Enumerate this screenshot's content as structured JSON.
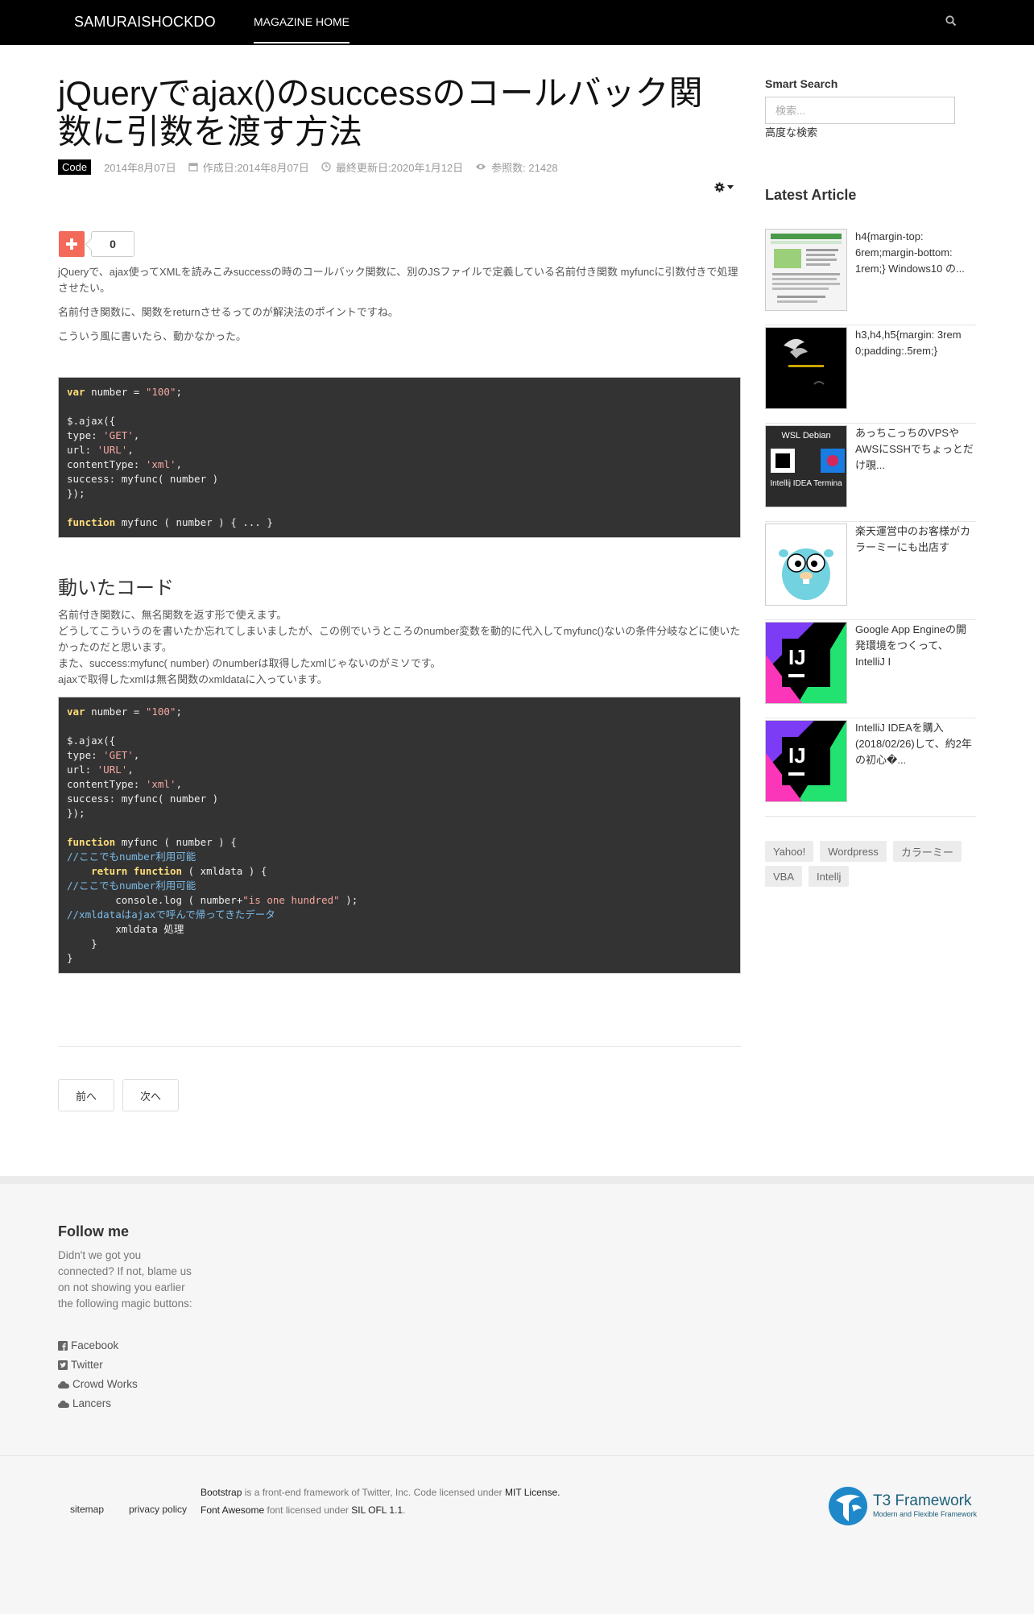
{
  "navbar": {
    "brand": "SAMURAISHOCKDO",
    "home": "MAGAZINE HOME",
    "search_icon": "search-icon"
  },
  "article": {
    "title": "jQueryでajax()のsuccessのコールバック関数に引数を渡す方法",
    "category": "Code",
    "published": "2014年8月07日",
    "created": "作成日:2014年8月07日",
    "modified": "最終更新日:2020年1月12日",
    "hits": "参照数: 21428",
    "share_count": "0",
    "p1": "jQueryで、ajax使ってXMLを読みこみsuccessの時のコールバック関数に、別のJSファイルで定義している名前付き関数 myfuncに引数付きで処理させたい。",
    "p2": "名前付き関数に、関数をreturnさせるってのが解決法のポイントですね。",
    "p3": "こういう風に書いたら、動かなかった。",
    "code1": [
      [
        {
          "t": "var",
          "c": "kw"
        },
        {
          "t": " number = "
        },
        {
          "t": "\"100\"",
          "c": "str"
        },
        {
          "t": ";"
        }
      ],
      [],
      [
        {
          "t": "$.ajax({"
        }
      ],
      [
        {
          "t": "type: "
        },
        {
          "t": "'GET'",
          "c": "str"
        },
        {
          "t": ","
        }
      ],
      [
        {
          "t": "url: "
        },
        {
          "t": "'URL'",
          "c": "str"
        },
        {
          "t": ","
        }
      ],
      [
        {
          "t": "contentType: "
        },
        {
          "t": "'xml'",
          "c": "str"
        },
        {
          "t": ","
        }
      ],
      [
        {
          "t": "success: myfunc( number )"
        }
      ],
      [
        {
          "t": "});"
        }
      ],
      [],
      [
        {
          "t": "function",
          "c": "kw"
        },
        {
          "t": " myfunc ( number ) { ... }"
        }
      ]
    ],
    "heading2": "動いたコード",
    "p4": "名前付き関数に、無名関数を返す形で使えます。\nどうしてこういうのを書いたか忘れてしまいましたが、この例でいうところのnumber変数を動的に代入してmyfunc()ないの条件分岐などに使いたかったのだと思います。\nまた、success:myfunc( number) のnumberは取得したxmlじゃないのがミソです。\najaxで取得したxmlは無名関数のxmldataに入っています。",
    "code2": [
      [
        {
          "t": "var",
          "c": "kw"
        },
        {
          "t": " number = "
        },
        {
          "t": "\"100\"",
          "c": "str"
        },
        {
          "t": ";"
        }
      ],
      [],
      [
        {
          "t": "$.ajax({"
        }
      ],
      [
        {
          "t": "type: "
        },
        {
          "t": "'GET'",
          "c": "str"
        },
        {
          "t": ","
        }
      ],
      [
        {
          "t": "url: "
        },
        {
          "t": "'URL'",
          "c": "str"
        },
        {
          "t": ","
        }
      ],
      [
        {
          "t": "contentType: "
        },
        {
          "t": "'xml'",
          "c": "str"
        },
        {
          "t": ","
        }
      ],
      [
        {
          "t": "success: myfunc( number )"
        }
      ],
      [
        {
          "t": "});"
        }
      ],
      [],
      [
        {
          "t": "function",
          "c": "kw"
        },
        {
          "t": " myfunc ( number ) {"
        }
      ],
      [
        {
          "t": "//ここでもnumber利用可能",
          "c": "cm"
        }
      ],
      [
        {
          "t": "    "
        },
        {
          "t": "return",
          "c": "kw"
        },
        {
          "t": " "
        },
        {
          "t": "function",
          "c": "kw"
        },
        {
          "t": " ( xmldata ) {"
        }
      ],
      [
        {
          "t": "//ここでもnumber利用可能",
          "c": "cm"
        }
      ],
      [
        {
          "t": "        console.log ( number+"
        },
        {
          "t": "\"is one hundred\"",
          "c": "str"
        },
        {
          "t": " );"
        }
      ],
      [
        {
          "t": "//xmldataはajaxで呼んで帰ってきたデータ",
          "c": "cm"
        }
      ],
      [
        {
          "t": "        xmldata 処理"
        }
      ],
      [
        {
          "t": "    }"
        }
      ],
      [
        {
          "t": "}"
        }
      ]
    ],
    "prev": "前へ",
    "next": "次へ"
  },
  "sidebar": {
    "smart_search_title": "Smart Search",
    "search_placeholder": "検索...",
    "advanced_search": "高度な検索",
    "latest_title": "Latest Article",
    "latest": [
      {
        "text": "h4{margin-top: 6rem;margin-bottom: 1rem;} Windows10 の..."
      },
      {
        "text": "h3,h4,h5{margin: 3rem 0;padding:.5rem;}"
      },
      {
        "text": "あっちこっちのVPSやAWSにSSHでちょっとだけ覗..."
      },
      {
        "text": "楽天運営中のお客様がカラーミーにも出店す"
      },
      {
        "text": "Google App Engineの開発環境をつくって、IntelliJ I"
      },
      {
        "text": "IntelliJ IDEAを購入(2018/02/26)して、約2年の初心�..."
      }
    ],
    "thumb_wsl_title": "WSL Debian",
    "thumb_wsl_caption": "Intellij IDEA Termina",
    "tags": [
      "Yahoo!",
      "Wordpress",
      "カラーミー",
      "VBA",
      "Intellj"
    ]
  },
  "footer": {
    "follow_title": "Follow me",
    "follow_text": "Didn't we got you connected? If not, blame us on not showing you earlier the following magic buttons:",
    "social": [
      "Facebook",
      "Twitter",
      "Crowd Works",
      "Lancers"
    ],
    "sitemap": "sitemap",
    "privacy": "privacy policy",
    "credit1_a": "Bootstrap",
    "credit1_b": " is a front-end framework of Twitter, Inc. Code licensed under ",
    "credit1_c": "MIT License.",
    "credit2_a": "Font Awesome",
    "credit2_b": " font licensed under ",
    "credit2_c": "SIL OFL 1.1",
    "credit2_d": ".",
    "t3_name": "T3 Framework",
    "t3_sub": "Modern and Flexible Framework"
  },
  "colors": {
    "navbar": "#000000",
    "share": "#f3695a",
    "code_bg": "#333333",
    "t3": "#1b5f7a"
  }
}
